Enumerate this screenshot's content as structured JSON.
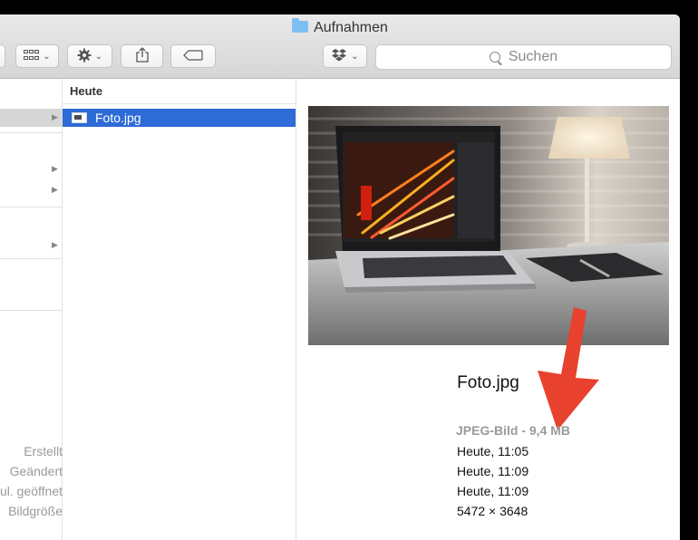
{
  "window": {
    "title": "Aufnahmen"
  },
  "search": {
    "placeholder": "Suchen"
  },
  "column": {
    "header": "Heute",
    "selected_file": "Foto.jpg"
  },
  "preview": {
    "filename": "Foto.jpg",
    "kind": "JPEG-Bild - 9,4 MB",
    "info": [
      {
        "label": "Erstellt",
        "value": "Heute, 11:05"
      },
      {
        "label": "Geändert",
        "value": "Heute, 11:09"
      },
      {
        "label": "Zul. geöffnet",
        "value": "Heute, 11:09"
      },
      {
        "label": "Bildgröße",
        "value": "5472 × 3648"
      }
    ]
  },
  "colors": {
    "selection": "#2d6bd6",
    "annotation_arrow": "#e8412e"
  }
}
